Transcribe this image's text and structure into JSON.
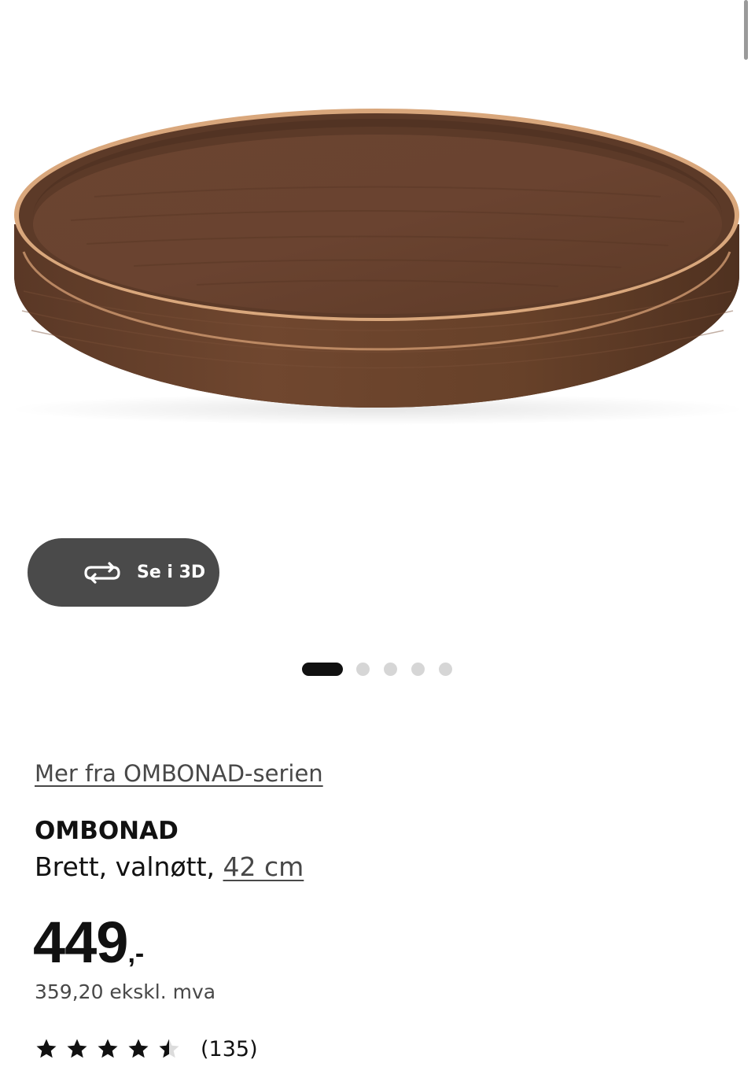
{
  "viewer": {
    "button_3d_label": "Se i 3D",
    "button_3d_icon": "rotate-3d-icon",
    "carousel_total": 5,
    "carousel_active_index": 1
  },
  "product": {
    "series_link": "Mer fra OMBONAD-serien",
    "name": "OMBONAD",
    "description": "Brett, valnøtt, ",
    "size": "42 cm",
    "price_main": "449",
    "price_suffix": ",-",
    "price_ex_vat": "359,20 ekskl. mva",
    "rating": {
      "value": 4.5,
      "max": 5,
      "count_label": "(135)"
    }
  },
  "colors": {
    "button_dark": "#4a4a4a",
    "text_primary": "#111111",
    "text_secondary": "#484848",
    "dot_inactive": "#d6d6d6",
    "wood": "#6b4530"
  }
}
